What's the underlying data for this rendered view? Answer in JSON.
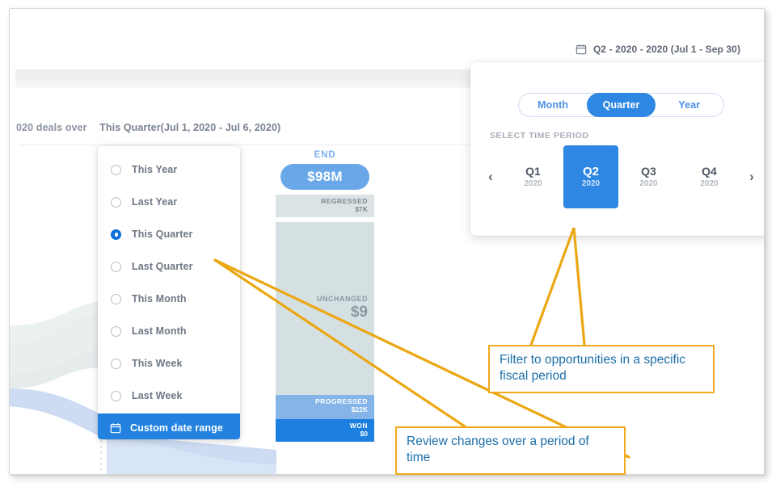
{
  "header": {
    "summary_prefix": "020 deals over",
    "range_label": "This Quarter(Jul 1, 2020 - Jul 6, 2020)"
  },
  "date_label": {
    "icon": "calendar-icon",
    "text": "Q2 - 2020 - 2020 (Jul 1 - Sep 30)"
  },
  "period_menu": {
    "items": [
      {
        "label": "This Year",
        "selected": false
      },
      {
        "label": "Last Year",
        "selected": false
      },
      {
        "label": "This Quarter",
        "selected": true
      },
      {
        "label": "Last Quarter",
        "selected": false
      },
      {
        "label": "This Month",
        "selected": false
      },
      {
        "label": "Last Month",
        "selected": false
      },
      {
        "label": "This Week",
        "selected": false
      },
      {
        "label": "Last Week",
        "selected": false
      }
    ],
    "custom": {
      "label": "Custom date range",
      "icon": "calendar-icon"
    }
  },
  "fiscal_popover": {
    "segments": [
      {
        "label": "Month",
        "active": false
      },
      {
        "label": "Quarter",
        "active": true
      },
      {
        "label": "Year",
        "active": false
      }
    ],
    "section_label": "SELECT TIME PERIOD",
    "prev_icon": "chevron-left-icon",
    "next_icon": "chevron-right-icon",
    "quarters": [
      {
        "quarter": "Q1",
        "year": "2020",
        "active": false
      },
      {
        "quarter": "Q2",
        "year": "2020",
        "active": true
      },
      {
        "quarter": "Q3",
        "year": "2020",
        "active": false
      },
      {
        "quarter": "Q4",
        "year": "2020",
        "active": false
      }
    ]
  },
  "funnel": {
    "title": "END",
    "total": "$98M",
    "rows": [
      {
        "label": "REGRESSED",
        "value": "$7K"
      },
      {
        "label": "UNCHANGED",
        "value": "$9"
      },
      {
        "label": "PROGRESSED",
        "value": "$22K"
      },
      {
        "label": "WON",
        "value": "$0"
      }
    ]
  },
  "annotations": [
    {
      "id": "fiscal",
      "text": "Filter to opportunities in a specific fiscal period"
    },
    {
      "id": "review",
      "text": "Review changes over a period of time"
    }
  ],
  "colors": {
    "accent_blue": "#2d87e3",
    "selected_blue": "#2381e0",
    "annotation_border": "#f0a91c",
    "annotation_text": "#1b6ea8",
    "funnel_pill": "#6aa7e8",
    "funnel_won": "#1d7fe0",
    "funnel_progressed": "#84b4e8",
    "funnel_neutral": "#d5e0e2"
  }
}
